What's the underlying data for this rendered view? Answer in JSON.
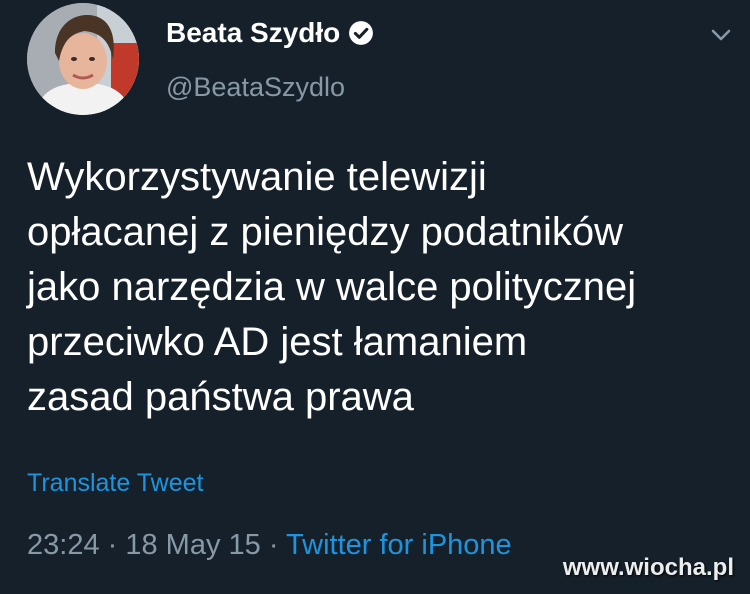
{
  "author": {
    "display_name": "Beata Szydło",
    "handle": "@BeataSzydlo",
    "verified_icon": "verified-badge-icon",
    "avatar_icon": "user-avatar"
  },
  "menu": {
    "icon": "chevron-down-icon"
  },
  "tweet": {
    "lines": [
      "Wykorzystywanie telewizji",
      "opłacanej z pieniędzy podatników",
      "jako narzędzia w walce politycznej",
      "przeciwko AD jest łamaniem",
      "zasad państwa prawa"
    ],
    "translate_label": "Translate Tweet"
  },
  "meta": {
    "time": "23:24",
    "separator": " · ",
    "date": "18 May 15",
    "source": "Twitter for iPhone"
  },
  "watermark": {
    "text": "www.wiocha.pl"
  },
  "colors": {
    "background": "#16202b",
    "text": "#ffffff",
    "secondary": "#8899a6",
    "link": "#1b95e0"
  }
}
